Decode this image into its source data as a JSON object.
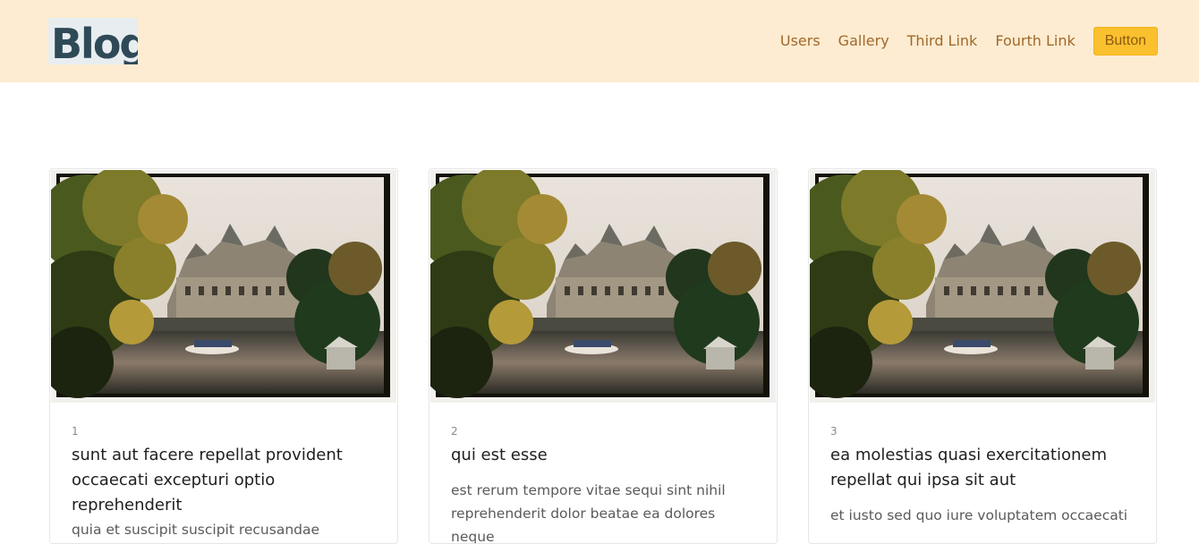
{
  "header": {
    "logo_text": "Blog",
    "nav": {
      "users": "Users",
      "gallery": "Gallery",
      "third": "Third Link",
      "fourth": "Fourth Link",
      "button": "Button"
    }
  },
  "posts": [
    {
      "number": "1",
      "title": "sunt aut facere repellat provident occaecati excepturi optio reprehenderit",
      "body": "quia et suscipit suscipit recusandae consequuntur expedita et cum"
    },
    {
      "number": "2",
      "title": "qui est esse",
      "body": "est rerum tempore vitae sequi sint nihil reprehenderit dolor beatae ea dolores neque"
    },
    {
      "number": "3",
      "title": "ea molestias quasi exercitationem repellat qui ipsa sit aut",
      "body": "et iusto sed quo iure voluptatem occaecati"
    }
  ],
  "colors": {
    "header_bg": "#fdecd1",
    "nav_link": "#a0682a",
    "button_bg": "#fbc02d"
  }
}
